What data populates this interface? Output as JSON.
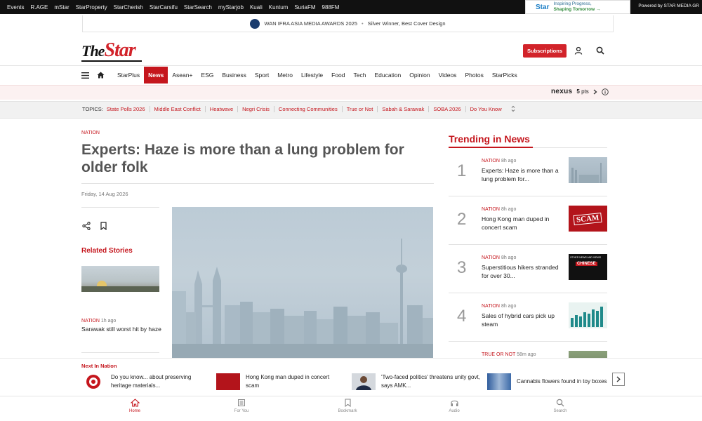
{
  "topbar": {
    "links": [
      "Events",
      "R.AGE",
      "mStar",
      "StarProperty",
      "StarCherish",
      "StarCarsifu",
      "StarSearch",
      "myStarjob",
      "Kuali",
      "Kuntum",
      "SuriaFM",
      "988FM"
    ],
    "promo_badge": "Star",
    "promo_line1": "Inspiring Progress,",
    "promo_line2": "Shaping Tomorrow →",
    "powered": "Powered by STAR MEDIA GR"
  },
  "award": {
    "name": "WAN IFRA ASIA MEDIA AWARDS 2025",
    "detail": "Silver Winner, Best Cover Design"
  },
  "header": {
    "logo_the": "The",
    "logo_star": "Star",
    "subscribe_label": "Subscriptions"
  },
  "nav": {
    "items": [
      "StarPlus",
      "News",
      "Asean+",
      "ESG",
      "Business",
      "Sport",
      "Metro",
      "Lifestyle",
      "Food",
      "Tech",
      "Education",
      "Opinion",
      "Videos",
      "Photos",
      "StarPicks"
    ]
  },
  "nexus": {
    "brand": "nexus",
    "points": "5",
    "unit": "pts"
  },
  "topics": {
    "label": "TOPICS:",
    "items": [
      "State Polls 2026",
      "Middle East Conflict",
      "Heatwave",
      "Negri Crisis",
      "Connecting Communities",
      "True or Not",
      "Sabah & Sarawak",
      "SOBA 2026",
      "Do You Know"
    ]
  },
  "article": {
    "category": "NATION",
    "headline": "Experts: Haze is more than a lung problem for older folk",
    "date": "Friday, 14 Aug 2026"
  },
  "related": {
    "title": "Related Stories",
    "items": [
      {
        "category": "NATION",
        "ago": "1h ago",
        "title": "Sarawak still worst hit by haze"
      }
    ]
  },
  "trending": {
    "title": "Trending in News",
    "items": [
      {
        "num": "1",
        "category": "NATION",
        "ago": "8h ago",
        "title": "Experts: Haze is more than a lung problem for..."
      },
      {
        "num": "2",
        "category": "NATION",
        "ago": "8h ago",
        "title": "Hong Kong man duped in concert scam"
      },
      {
        "num": "3",
        "category": "NATION",
        "ago": "8h ago",
        "title": "Superstitious hikers stranded for over 30..."
      },
      {
        "num": "4",
        "category": "NATION",
        "ago": "8h ago",
        "title": "Sales of hybrid cars pick up steam"
      },
      {
        "num": "5",
        "category": "TRUE OR NOT",
        "ago": "58m ago",
        "title": ""
      }
    ],
    "thumb_scam_text": "SCAM",
    "thumb_news_text": "OTHER NEWS AND VIEWS",
    "thumb_chinese_text": "CHINESE"
  },
  "next": {
    "title": "Next In Nation",
    "items": [
      {
        "title": "Do you know... about preserving heritage materials..."
      },
      {
        "title": "Hong Kong man duped in concert scam"
      },
      {
        "title": "'Two-faced politics' threatens unity govt, says AMK..."
      },
      {
        "title": "Cannabis flowers found in toy boxes"
      }
    ]
  },
  "tabs": [
    "Home",
    "For You",
    "Bookmark",
    "Audio",
    "Search"
  ],
  "colors": {
    "brand_red": "#c5161d",
    "accent_red": "#d2232a"
  }
}
